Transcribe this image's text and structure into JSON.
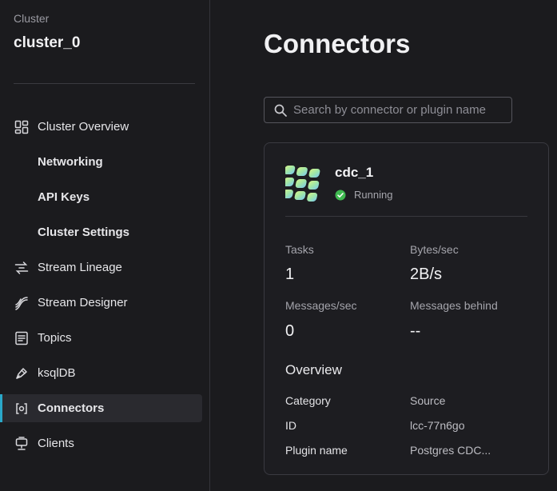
{
  "sidebar": {
    "caption": "Cluster",
    "cluster_name": "cluster_0",
    "items": [
      {
        "label": "Cluster Overview",
        "icon": "dashboard-icon"
      },
      {
        "label": "Networking"
      },
      {
        "label": "API Keys"
      },
      {
        "label": "Cluster Settings"
      },
      {
        "label": "Stream Lineage",
        "icon": "stream-lineage-icon"
      },
      {
        "label": "Stream Designer",
        "icon": "stream-designer-icon"
      },
      {
        "label": "Topics",
        "icon": "topics-icon"
      },
      {
        "label": "ksqlDB",
        "icon": "ksqldb-icon"
      },
      {
        "label": "Connectors",
        "icon": "connectors-icon",
        "active": true
      },
      {
        "label": "Clients",
        "icon": "clients-icon"
      }
    ],
    "accent_color": "#2aa8c9"
  },
  "main": {
    "title": "Connectors",
    "search": {
      "placeholder": "Search by connector or plugin name",
      "value": ""
    },
    "connector": {
      "name": "cdc_1",
      "status": "Running",
      "status_color": "#3fb950",
      "metrics": {
        "tasks_label": "Tasks",
        "tasks_value": "1",
        "bytes_label": "Bytes/sec",
        "bytes_value": "2B/s",
        "messages_label": "Messages/sec",
        "messages_value": "0",
        "behind_label": "Messages behind",
        "behind_value": "--"
      },
      "overview": {
        "title": "Overview",
        "rows": [
          {
            "key": "Category",
            "value": "Source"
          },
          {
            "key": "ID",
            "value": "lcc-77n6go"
          },
          {
            "key": "Plugin name",
            "value": "Postgres CDC..."
          }
        ]
      }
    }
  }
}
